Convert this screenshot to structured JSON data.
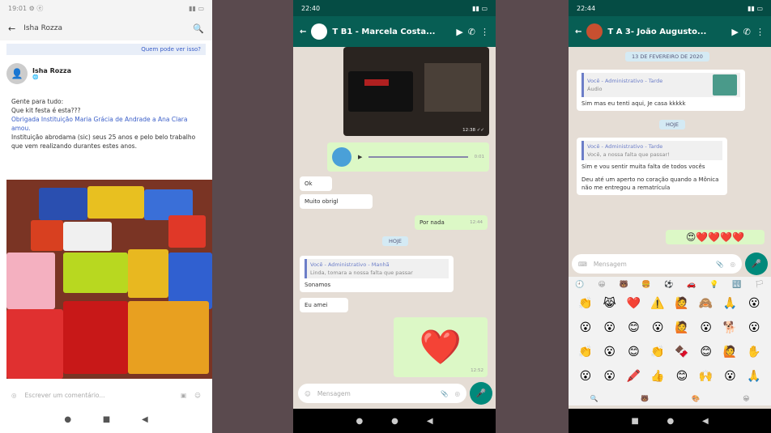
{
  "phone1": {
    "status_time": "19:01 ⚙ ⓔ",
    "search_query": "Isha Rozza",
    "who_can_see": "Quem pode ver isso?",
    "poster_name": "Isha Rozza",
    "post_lines": [
      "Gente para tudo:",
      "Que kit festa é esta???",
      "Obrigada Instituição Maria Grácia de Andrade a Ana Clara amou.",
      "Instituição abrodama (sic) seus 25 anos e pelo belo trabalho que vem realizando durantes estes anos."
    ],
    "comment_placeholder": "Escrever um comentário...",
    "nav": [
      "●",
      "■",
      "◀"
    ]
  },
  "phone2": {
    "status_time": "22:40",
    "contact": "T B1 - Marcela Costa...",
    "photo_time": "12:38 ✓✓",
    "audio_time": "0:01",
    "msg_ok": "Ok",
    "msg_muito": "Muito obrigl",
    "msg_por_nada": "Por nada",
    "msg_por_nada_time": "12:44",
    "date_chip": "HOJE",
    "quote_title": "Você - Administrativo - Manhã",
    "quote_sub": "Linda, tomara a nossa falta que passar",
    "msg_sonamos": "Sonamos",
    "msg_eu": "Eu amei",
    "heart": "❤️",
    "heart_time": "12:52",
    "input_placeholder": "Mensagem",
    "nav": [
      "●",
      "●",
      "◀"
    ]
  },
  "phone3": {
    "status_time": "22:44",
    "contact": "T A 3- João Augusto...",
    "date_top": "13 DE FEVEREIRO DE 2020",
    "quote1_title": "Você - Administrativo - Tarde",
    "quote1_sub": "Áudio",
    "msg1": "Sim mas eu tenti aqui, Je casa kkkkk",
    "date_chip": "HOJE",
    "quote2_title": "Você - Administrativo - Tarde",
    "quote2_sub": "Você, a nossa falta que passar!",
    "msg2a": "Sim e vou sentir muita falta de todos vocês",
    "msg2b": "Deu até um aperto no coração quando a Mônica não me entregou a rematrícula",
    "hearts_out": "😍❤️❤️❤️❤️",
    "input_placeholder": "Mensagem",
    "tabs": [
      "🕘",
      "😀",
      "🐻",
      "🍔",
      "⚽",
      "🚗",
      "💡",
      "🔣",
      "🏳"
    ],
    "emojis": [
      "👏",
      "😹",
      "❤️",
      "⚠️",
      "🙋",
      "🙈",
      "🙏",
      "😮",
      "😮",
      "😮",
      "😊",
      "😮",
      "🙋",
      "😮",
      "🐕",
      "😮",
      "👏",
      "😮",
      "😊",
      "👏",
      "🍫",
      "😊",
      "🙋",
      "✋",
      "😮",
      "😮",
      "🖍️",
      "👍",
      "😊",
      "🙌",
      "😮",
      "🙏"
    ],
    "kb_bar": [
      "🔍",
      "🐻",
      "🎨",
      "😀"
    ],
    "nav": [
      "■",
      "●",
      "◀"
    ]
  }
}
